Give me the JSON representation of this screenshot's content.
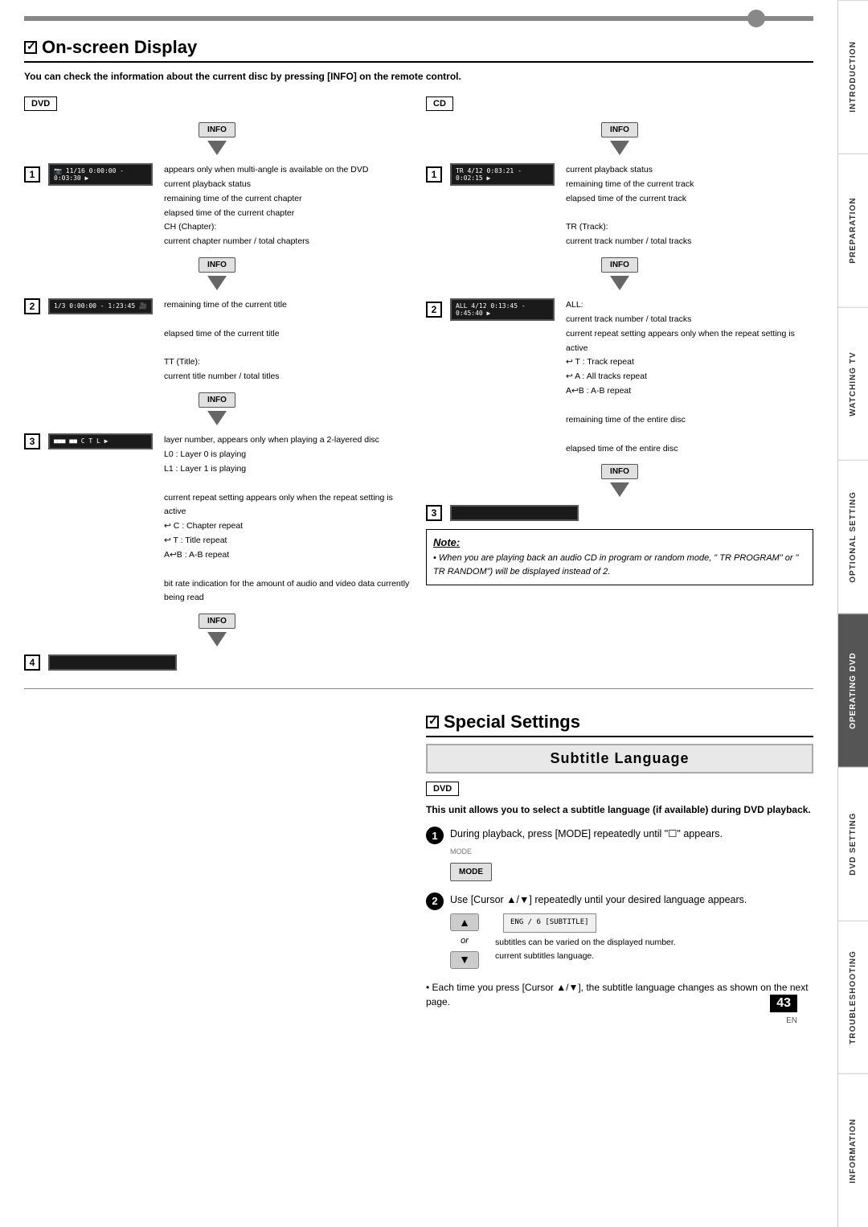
{
  "topBar": {},
  "sidebar": {
    "tabs": [
      {
        "label": "INTRODUCTION",
        "active": false
      },
      {
        "label": "PREPARATION",
        "active": false
      },
      {
        "label": "WATCHING TV",
        "active": false
      },
      {
        "label": "OPTIONAL SETTING",
        "active": false
      },
      {
        "label": "OPERATING DVD",
        "active": true
      },
      {
        "label": "DVD SETTING",
        "active": false
      },
      {
        "label": "TROUBLESHOOTING",
        "active": false
      },
      {
        "label": "INFORMATION",
        "active": false
      }
    ]
  },
  "onscreenDisplay": {
    "title": "On-screen Display",
    "introText": "You can check the information about the current disc by pressing [INFO] on the remote control.",
    "dvdLabel": "DVD",
    "cdLabel": "CD",
    "dvdAnnotations": {
      "line1": "appears only when multi-angle is available on the DVD",
      "line2": "current playback status",
      "line3": "remaining time of the current chapter",
      "line4": "elapsed time of the current chapter",
      "line5": "CH (Chapter):",
      "line6": "current chapter number / total chapters",
      "line7": "remaining time of the current title",
      "line8": "elapsed time of the current title",
      "line9": "TT (Title):",
      "line10": "current title number / total titles",
      "line11": "layer number, appears only when playing a 2-layered disc",
      "line12": "L0 :  Layer 0 is playing",
      "line13": "L1 :  Layer 1 is playing",
      "line14": "current repeat setting appears only when the repeat setting is active",
      "line15": "↩ C :  Chapter repeat",
      "line16": "↩ T :  Title repeat",
      "line17": "A↩B :  A-B repeat",
      "line18": "bit rate indication for the amount of audio and video data currently being read"
    },
    "cdAnnotations": {
      "line1": "current playback status",
      "line2": "remaining time of the current track",
      "line3": "elapsed time of the current track",
      "line4": "TR (Track):",
      "line5": "current track number / total tracks",
      "line6": "ALL:",
      "line7": "current track number / total tracks",
      "line8": "current repeat setting appears only when the repeat setting is active",
      "line9": "↩ T :  Track repeat",
      "line10": "↩ A :  All tracks repeat",
      "line11": "A↩B :  A-B repeat",
      "line12": "remaining time of the entire disc",
      "line13": "elapsed time of the entire disc"
    },
    "dvdScreen1": "11/16  0:00:00 - 0:03:30",
    "dvdScreen2": "1/3  0:00:00 - 1:23:45",
    "dvdScreen3": "...",
    "cdScreen1": "4/12  0:03:21 - 0:02:15",
    "cdScreen2": "ALL  4/12  0:13:45 - 0:45:40",
    "note": {
      "title": "Note:",
      "text": "• When you are playing back an audio CD in program or random mode, \" TR  PROGRAM\" or \" TR  RANDOM\") will be displayed instead of 2."
    }
  },
  "specialSettings": {
    "title": "Special Settings",
    "subtitleLanguage": {
      "heading": "Subtitle Language",
      "dvdLabel": "DVD",
      "introText": "This unit allows you to select a subtitle language (if available) during DVD playback.",
      "step1": {
        "num": "1",
        "text": "During playback, press [MODE] repeatedly until \"☐\" appears.",
        "modeLabel": "MODE"
      },
      "step2": {
        "num": "2",
        "text": "Use [Cursor ▲/▼] repeatedly until your desired language appears.",
        "orText": "or",
        "displayText": "ENG / 6  [SUBTITLE]",
        "callout1": "subtitles can be varied on the displayed number.",
        "callout2": "current subtitles language."
      },
      "bulletText": "• Each time you press [Cursor ▲/▼], the subtitle language changes as shown on the next page."
    }
  },
  "pageNumber": "43",
  "pageLocale": "EN"
}
